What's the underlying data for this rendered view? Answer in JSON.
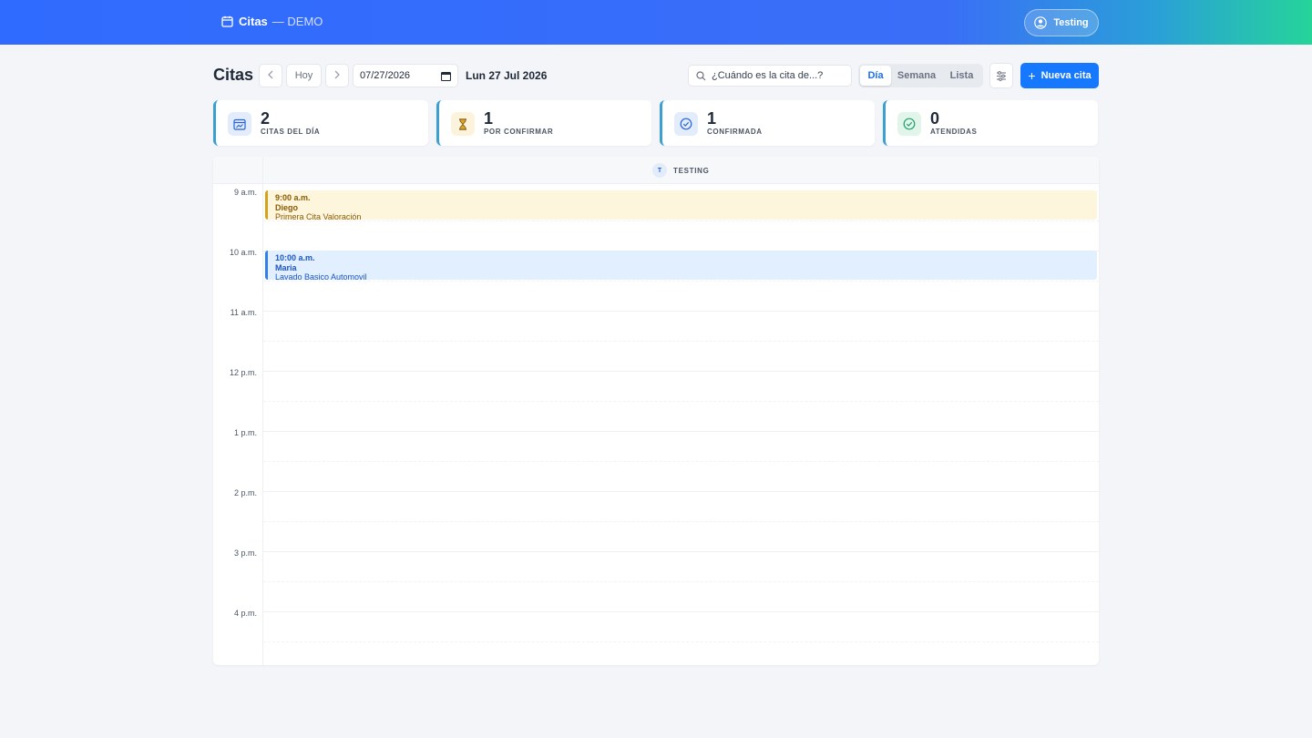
{
  "header": {
    "app_name": "Citas",
    "subtitle": "— DEMO",
    "user_label": "Testing"
  },
  "toolbar": {
    "title": "Citas",
    "today_label": "Hoy",
    "date_value": "07/27/2026",
    "date_display": "Lun 27 Jul 2026",
    "search_placeholder": "¿Cuándo es la cita de...?",
    "views": [
      "Día",
      "Semana",
      "Lista"
    ],
    "active_view": "Día",
    "new_label": "Nueva cita"
  },
  "stats": [
    {
      "value": "2",
      "label": "CITAS DEL DÍA",
      "icon": "calendar-chart-icon"
    },
    {
      "value": "1",
      "label": "POR CONFIRMAR",
      "icon": "hourglass-icon"
    },
    {
      "value": "1",
      "label": "CONFIRMADA",
      "icon": "check-circle-icon"
    },
    {
      "value": "0",
      "label": "ATENDIDAS",
      "icon": "check-circle-icon"
    }
  ],
  "calendar": {
    "staff_initial": "T",
    "staff_name": "TESTING",
    "hours": [
      "9 a.m.",
      "10 a.m.",
      "11 a.m.",
      "12 p.m.",
      "1 p.m.",
      "2 p.m.",
      "3 p.m.",
      "4 p.m."
    ],
    "events": [
      {
        "time": "9:00 a.m.",
        "client": "Diego",
        "service": "Primera Cita Valoración",
        "status": "por confirmar",
        "color": "#d4a21b"
      },
      {
        "time": "10:00 a.m.",
        "client": "Maria",
        "service": "Lavado Basico Automovil",
        "status": "confirmada",
        "color": "#2f80ed"
      }
    ]
  },
  "colors": {
    "primary": "#1677ff",
    "header_gradient_start": "#2f6bff",
    "header_gradient_end": "#26d49a"
  }
}
